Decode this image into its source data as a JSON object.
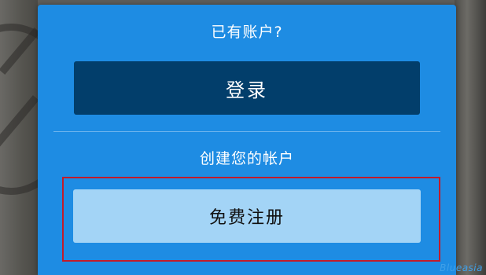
{
  "account_panel": {
    "have_account_text": "已有账户?",
    "login_label": "登录",
    "create_account_text": "创建您的帐户",
    "register_label": "免费注册"
  },
  "watermark": {
    "text": "Blueasia"
  },
  "colors": {
    "panel_bg": "#1e8ce3",
    "login_bg": "#023e6b",
    "register_bg": "#a3d4f6",
    "highlight_border": "#c21b2a"
  }
}
